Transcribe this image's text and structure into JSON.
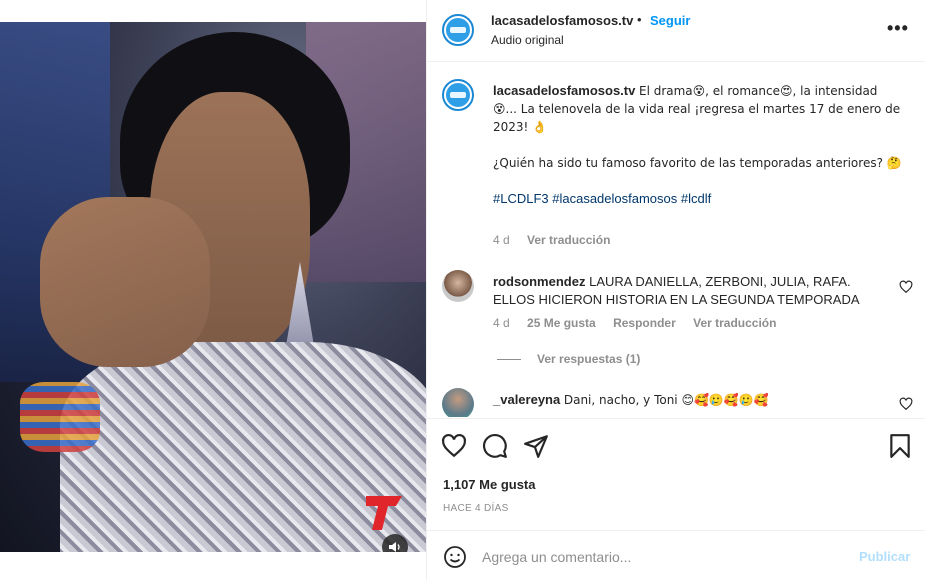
{
  "header": {
    "username": "lacasadelosfamosos.tv",
    "separator": "•",
    "follow_label": "Seguir",
    "audio_label": "Audio original",
    "more_label": "•••"
  },
  "caption": {
    "username": "lacasadelosfamosos.tv",
    "line1": "El drama😵, el romance😍, la intensidad 😵... La telenovela de la vida real ¡regresa el martes 17 de enero de 2023! 👌",
    "line2": "¿Quién ha sido tu famoso favorito de las temporadas anteriores? 🤔",
    "hashtags": "#LCDLF3 #lacasadelosfamosos #lcdlf",
    "age": "4 d",
    "translate": "Ver traducción"
  },
  "comments": [
    {
      "username": "rodsonmendez",
      "text": "LAURA DANIELLA, ZERBONI, JULIA, RAFA. ELLOS HICIERON HISTORIA EN LA SEGUNDA TEMPORADA",
      "age": "4 d",
      "likes": "25 Me gusta",
      "reply": "Responder",
      "translate": "Ver traducción",
      "view_replies": "Ver respuestas (1)"
    },
    {
      "username": "_valereyna",
      "text": "Dani, nacho, y Toni 😊🥰🥲🥰🥲🥰"
    }
  ],
  "actions": {
    "likes": "1,107 Me gusta",
    "time_ago": "HACE 4 DÍAS"
  },
  "add_comment": {
    "placeholder": "Agrega un comentario...",
    "post_label": "Publicar"
  },
  "colors": {
    "accent": "#0095f6",
    "hashtag": "#00376b",
    "muted": "#8e8e8e",
    "post_disabled": "#b2dffc",
    "telemundo_red": "#e0262b"
  },
  "icons": {
    "more": "more-icon",
    "like": "heart-icon",
    "comment": "comment-icon",
    "share": "share-icon",
    "save": "bookmark-icon",
    "emoji": "emoji-icon",
    "sound": "speaker-icon",
    "brand_logo": "telemundo-logo"
  }
}
